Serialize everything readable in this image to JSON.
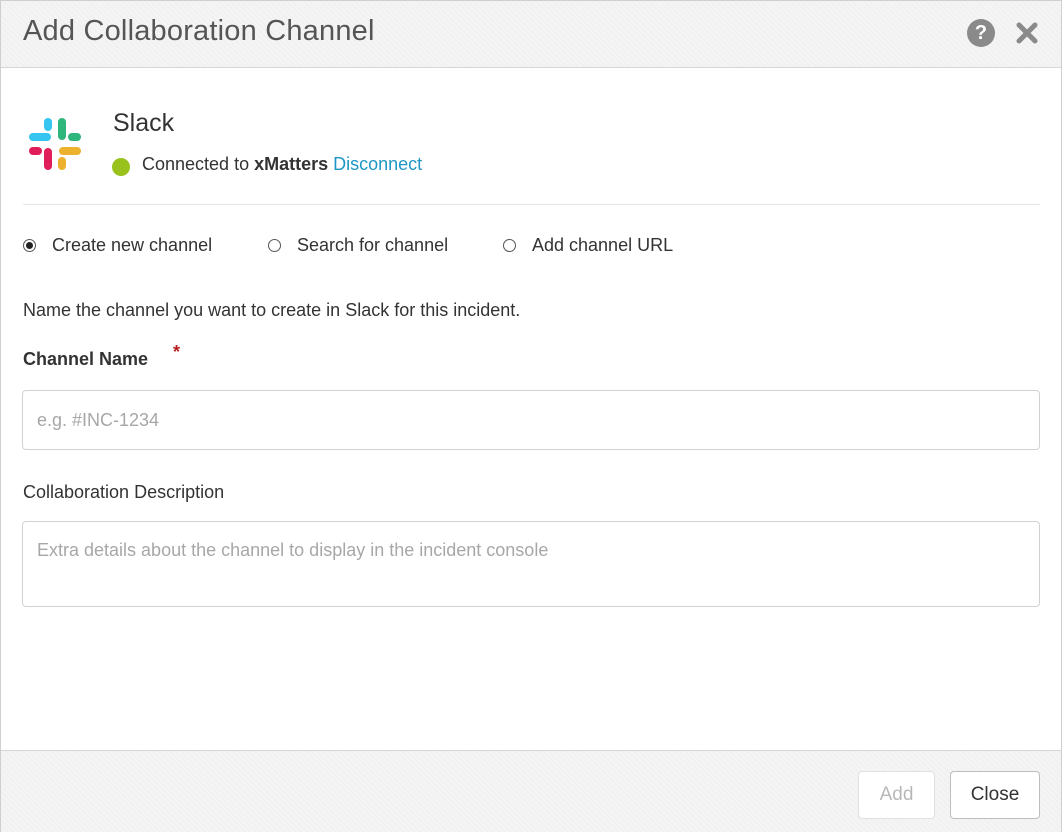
{
  "dialog": {
    "title": "Add Collaboration Channel",
    "help_icon": "question-circle-icon",
    "close_icon": "close-x-icon"
  },
  "integration": {
    "name": "Slack",
    "logo_icon": "slack-logo-icon",
    "status_color": "#99c21c",
    "status_prefix": "Connected to",
    "workspace": "xMatters",
    "disconnect_label": "Disconnect"
  },
  "mode": {
    "options": [
      {
        "label": "Create new channel",
        "selected": true
      },
      {
        "label": "Search for channel",
        "selected": false
      },
      {
        "label": "Add channel URL",
        "selected": false
      }
    ]
  },
  "form": {
    "intro": "Name the channel you want to create in Slack for this incident.",
    "channel_name_label": "Channel Name",
    "required_marker": "*",
    "channel_name_value": "",
    "channel_name_placeholder": "e.g. #INC-1234",
    "description_label": "Collaboration Description",
    "description_value": "",
    "description_placeholder": "Extra details about the channel to display in the incident console"
  },
  "footer": {
    "add_label": "Add",
    "add_enabled": false,
    "close_label": "Close"
  },
  "colors": {
    "link": "#1f97c4",
    "required": "#b51f1f"
  }
}
